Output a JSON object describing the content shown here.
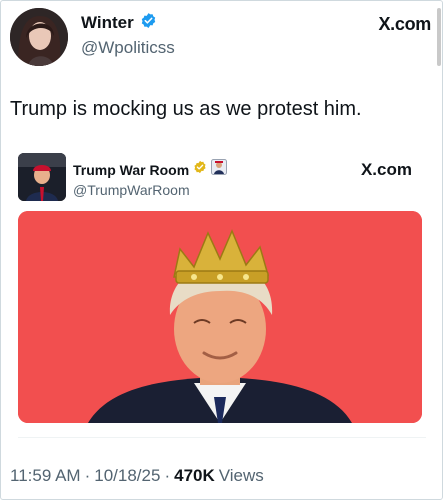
{
  "author": {
    "display_name": "Winter",
    "handle": "@Wpoliticss",
    "verified_icon": "verified-badge-blue",
    "site_label": "X.com"
  },
  "tweet": {
    "text": "Trump is mocking us as we protest him."
  },
  "quoted": {
    "display_name": "Trump War Room",
    "handle": "@TrumpWarRoom",
    "verified_icon": "verified-badge-gold",
    "affiliate_icon": "affiliate-badge",
    "site_label": "X.com",
    "image_description_icon": "trump-with-crown-image",
    "image_bg": "#f24f4f"
  },
  "meta": {
    "time": "11:59 AM",
    "sep1": "·",
    "date": "10/18/25",
    "sep2": "·",
    "views_count": "470K",
    "views_label": "Views"
  },
  "colors": {
    "verified_blue": "#1d9bf0",
    "verified_gold": "#e2b719",
    "muted_text": "#536471"
  }
}
